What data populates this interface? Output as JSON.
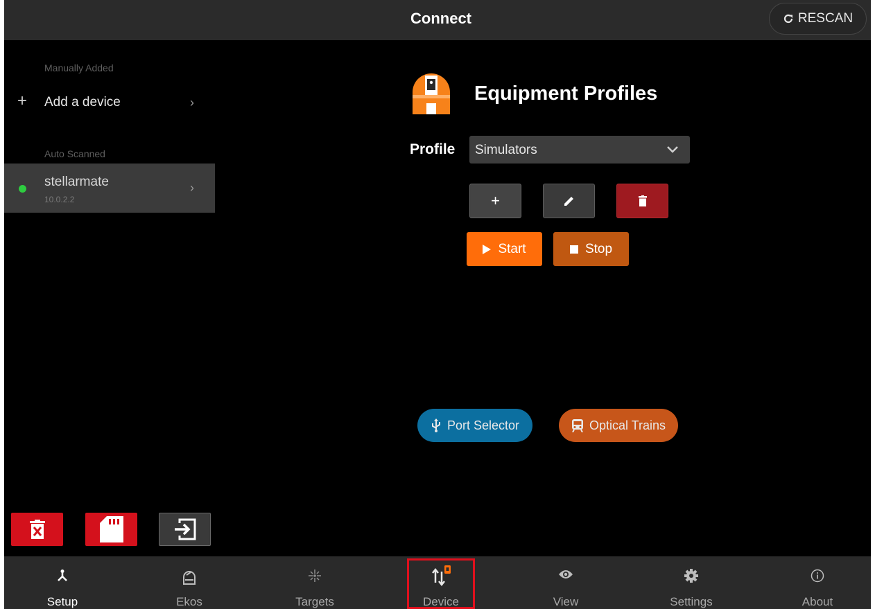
{
  "header": {
    "title": "Connect",
    "rescan_label": "RESCAN"
  },
  "sidebar": {
    "manual_section": "Manually Added",
    "add_device_label": "Add a device",
    "auto_section": "Auto Scanned",
    "devices": [
      {
        "name": "stellarmate",
        "ip": "10.0.2.2",
        "status": "online",
        "status_color": "#2ecc40"
      }
    ]
  },
  "main": {
    "title": "Equipment Profiles",
    "profile_label": "Profile",
    "profile_value": "Simulators",
    "start_label": "Start",
    "stop_label": "Stop",
    "port_selector_label": "Port Selector",
    "optical_trains_label": "Optical Trains"
  },
  "nav": {
    "items": [
      {
        "label": "Setup",
        "icon": "setup-icon",
        "active": true
      },
      {
        "label": "Ekos",
        "icon": "ekos-icon"
      },
      {
        "label": "Targets",
        "icon": "targets-icon"
      },
      {
        "label": "Device",
        "icon": "device-icon",
        "highlighted": true
      },
      {
        "label": "View",
        "icon": "eye-icon"
      },
      {
        "label": "Settings",
        "icon": "gear-icon"
      },
      {
        "label": "About",
        "icon": "info-icon"
      }
    ]
  },
  "colors": {
    "accent_orange": "#ff6d0a",
    "stop_orange": "#c05811",
    "danger_red": "#d4111c",
    "port_blue": "#0c6fa0",
    "highlight_red": "#e0101d"
  }
}
